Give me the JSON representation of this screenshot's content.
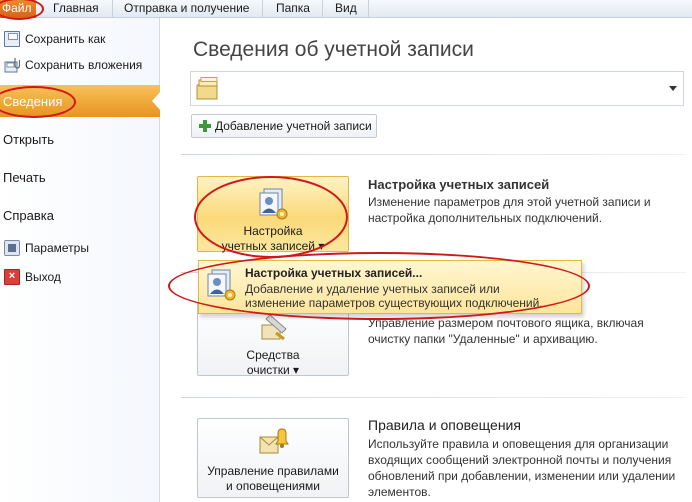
{
  "ribbon": {
    "tabs": [
      {
        "label": "Файл"
      },
      {
        "label": "Главная"
      },
      {
        "label": "Отправка и получение"
      },
      {
        "label": "Папка"
      },
      {
        "label": "Вид"
      }
    ]
  },
  "sidebar": {
    "items": [
      {
        "label": "Сохранить как",
        "icon": "save-as-icon"
      },
      {
        "label": "Сохранить вложения",
        "icon": "save-attachments-icon"
      },
      {
        "label": "Сведения"
      },
      {
        "label": "Открыть"
      },
      {
        "label": "Печать"
      },
      {
        "label": "Справка"
      },
      {
        "label": "Параметры",
        "icon": "options-icon"
      },
      {
        "label": "Выход",
        "icon": "exit-icon"
      }
    ]
  },
  "main": {
    "title": "Сведения об учетной записи",
    "add_account_label": "Добавление учетной записи",
    "sections": [
      {
        "button_label_1": "Настройка",
        "button_label_2": "учетных записей ▾",
        "heading": "Настройка учетных записей",
        "desc_1": "Изменение параметров для этой учетной записи и",
        "desc_2": "настройка дополнительных подключений."
      },
      {
        "button_label_1": "Средства",
        "button_label_2": "очистки ▾",
        "desc_1": "Управление размером почтового ящика, включая",
        "desc_2": "очистку папки \"Удаленные\" и архивацию."
      },
      {
        "button_label_1": "Управление правилами",
        "button_label_2": "и оповещениями",
        "heading": "Правила и оповещения",
        "desc_1": "Используйте правила и оповещения для организации",
        "desc_2": "входящих сообщений электронной почты и получения",
        "desc_3": "обновлений при добавлении, изменении или удалении",
        "desc_4": "элементов."
      }
    ]
  },
  "popup": {
    "title": "Настройка учетных записей...",
    "desc_1": "Добавление и удаление учетных записей или",
    "desc_2": "изменение параметров существующих подключений."
  },
  "colors": {
    "accent_orange": "#e8931f",
    "annotation_red": "#d01818",
    "highlight_yellow": "#fbd979"
  }
}
